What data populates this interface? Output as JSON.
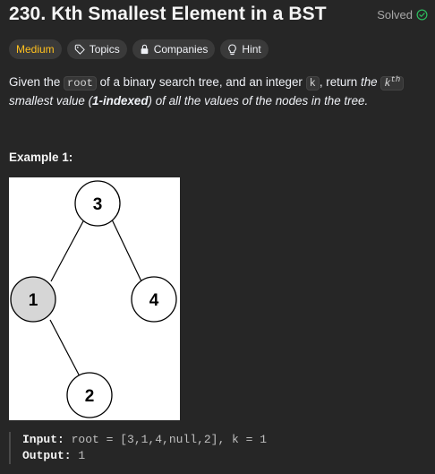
{
  "problem": {
    "title": "230. Kth Smallest Element in a BST",
    "status": "Solved"
  },
  "tags": {
    "difficulty": "Medium",
    "topics": "Topics",
    "companies": "Companies",
    "hint": "Hint"
  },
  "description": {
    "t1": "Given the ",
    "code_root": "root",
    "t2": " of a binary search tree, and an integer ",
    "code_k": "k",
    "t3": ", return ",
    "t4": "the ",
    "code_kth_base": "k",
    "code_kth_sup": "th",
    "t5": " smallest value (",
    "t6": "1-indexed",
    "t7": ") of all the values of the nodes in the tree."
  },
  "example": {
    "title": "Example 1:",
    "tree_nodes": [
      "3",
      "1",
      "4",
      "2"
    ],
    "input_label": "Input:",
    "input_value": " root = [3,1,4,null,2], k = 1",
    "output_label": "Output:",
    "output_value": " 1"
  },
  "colors": {
    "background": "#262626",
    "medium": "#ffc01e",
    "solved_check": "#2cbb5d"
  },
  "icons": {
    "solved": "check-circle-icon",
    "topics": "tag-icon",
    "companies": "lock-icon",
    "hint": "lightbulb-icon"
  }
}
